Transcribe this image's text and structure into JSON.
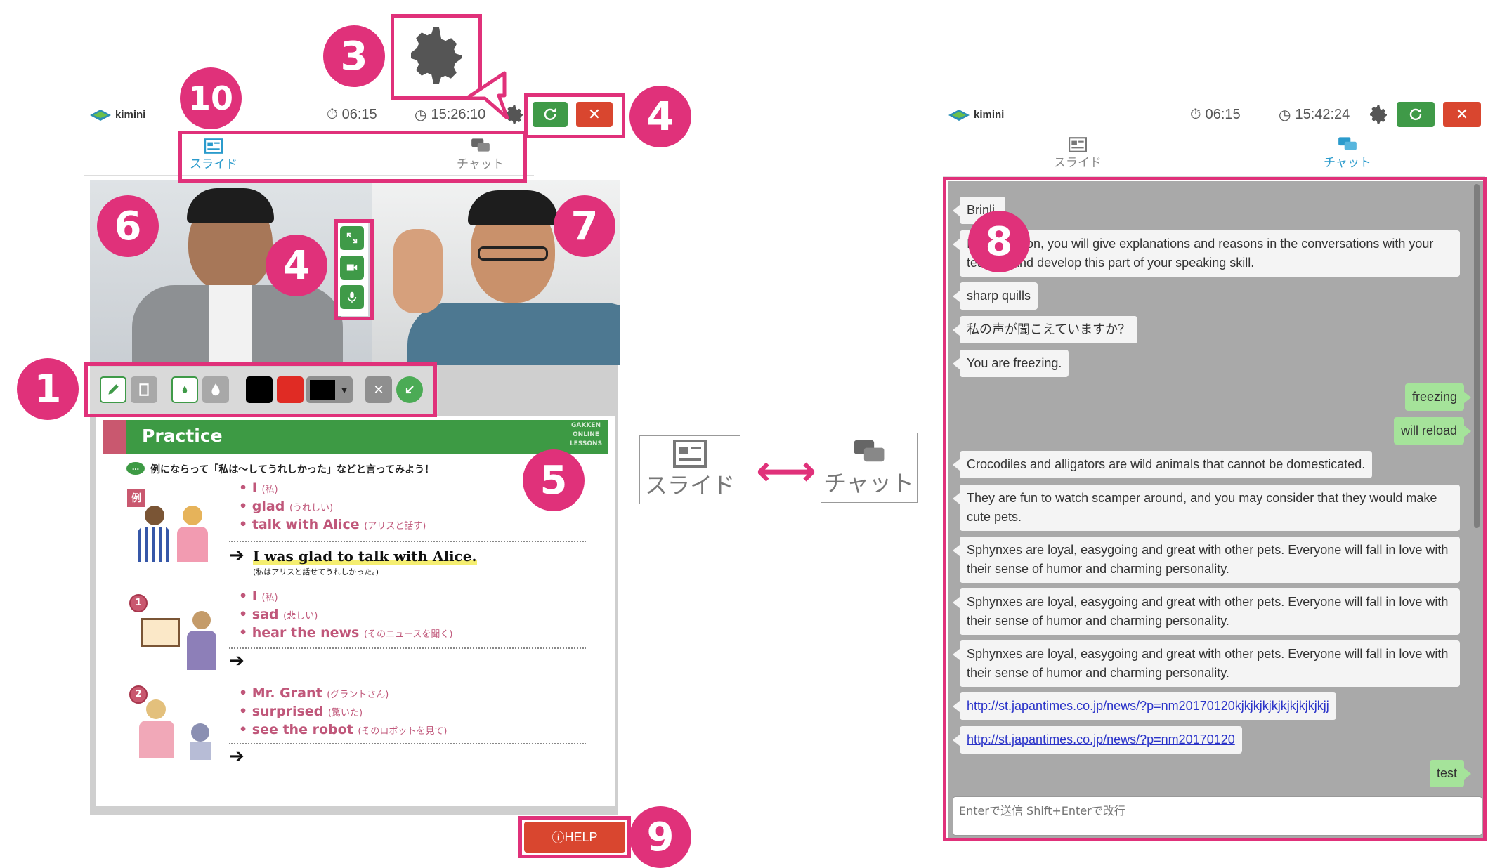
{
  "left_app": {
    "logo_text": "kimini",
    "timer_elapsed": "06:15",
    "clock_time": "15:26:10",
    "tabs": [
      {
        "label": "スライド",
        "active": true
      },
      {
        "label": "チャット",
        "active": false
      }
    ],
    "slide": {
      "title": "Practice",
      "brand": "GAKKEN ONLINE LESSONS",
      "instruction": "例にならって「私は〜してうれしかった」などと言ってみよう！",
      "example_badge": "例",
      "example_items": [
        "I",
        "glad",
        "talk with Alice"
      ],
      "example_notes": [
        "(私)",
        "(うれしい)",
        "(アリスと話す)"
      ],
      "example_answer": "I was glad to talk with Alice.",
      "example_answer_note": "(私はアリスと話せてうれしかった。)",
      "q1_badge": "1",
      "q1_items": [
        "I",
        "sad",
        "hear the news"
      ],
      "q1_notes": [
        "(私)",
        "(悲しい)",
        "(そのニュースを聞く)"
      ],
      "q2_badge": "2",
      "q2_items": [
        "Mr. Grant",
        "surprised",
        "see the robot"
      ],
      "q2_notes": [
        "(グラントさん)",
        "(驚いた)",
        "(そのロボットを見て)"
      ]
    },
    "help_label": "HELP",
    "help_icon": "ⓘ"
  },
  "right_app": {
    "logo_text": "kimini",
    "timer_elapsed": "06:15",
    "clock_time": "15:42:24",
    "tabs": [
      {
        "label": "スライド",
        "active": false
      },
      {
        "label": "チャット",
        "active": true
      }
    ],
    "messages": [
      {
        "side": "left",
        "text": "Brinli."
      },
      {
        "side": "left",
        "text": "In this lesson, you will give explanations and reasons in the conversations with your teacher and develop this part of your speaking skill."
      },
      {
        "side": "left",
        "text": "sharp quills"
      },
      {
        "side": "left",
        "text": "私の声が聞こえていますか？"
      },
      {
        "side": "left",
        "text": "You are freezing."
      },
      {
        "side": "right",
        "text": "freezing"
      },
      {
        "side": "right",
        "text": "will reload"
      },
      {
        "side": "left",
        "text": "Crocodiles and alligators are wild animals that cannot be domesticated."
      },
      {
        "side": "left",
        "text": "They are fun to watch scamper around, and you may consider that they would make cute pets."
      },
      {
        "side": "left",
        "text": "Sphynxes are loyal, easygoing and great with other pets. Everyone will fall in love with their sense of humor and charming personality."
      },
      {
        "side": "left",
        "text": "Sphynxes are loyal, easygoing and great with other pets. Everyone will fall in love with their sense of humor and charming personality."
      },
      {
        "side": "left",
        "text": "Sphynxes are loyal, easygoing and great with other pets. Everyone will fall in love with their sense of humor and charming personality."
      },
      {
        "side": "left",
        "text": "http://st.japantimes.co.jp/news/?p=nm20170120kjkjkjkjkjkjkjkjkjkjj",
        "link": true
      },
      {
        "side": "left",
        "text": "http://st.japantimes.co.jp/news/?p=nm20170120",
        "link": true
      },
      {
        "side": "right",
        "text": "test"
      }
    ],
    "input_placeholder": "Enterで送信 Shift+Enterで改行"
  },
  "middle": {
    "slide_label": "スライド",
    "chat_label": "チャット",
    "arrow": "⟷"
  },
  "callouts": [
    "1",
    "3",
    "4",
    "4",
    "5",
    "6",
    "7",
    "8",
    "9",
    "10"
  ],
  "colors": {
    "accent": "#e0317a",
    "green": "#3f9a48",
    "red": "#d9462f",
    "slide_green": "#3d9a44",
    "chat_bg": "#a9a9a9"
  }
}
